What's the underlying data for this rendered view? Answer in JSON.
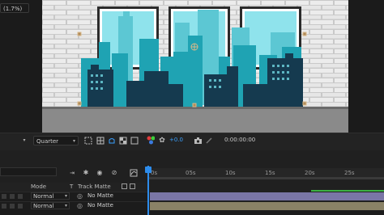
{
  "viewer": {
    "colors": {
      "sky": "#8fe3ec",
      "brick": "#e9e9e9",
      "mortar": "#c9c9c9",
      "floor": "#8a8a8a",
      "frame": "#2b2b2b",
      "mat": "#ffffff",
      "teal": "#1fa3b3",
      "teal_dark": "#16707e",
      "navy": "#153a4f"
    }
  },
  "toolbar": {
    "magnification": "(1.7%)",
    "resolution": "Quarter",
    "exposure": "+0.0",
    "timecode": "0:00:00:00",
    "icons": [
      "chevron-down-icon",
      "region-of-interest-icon",
      "grid-icon",
      "mask-icon",
      "channel-icon",
      "reset-exposure-icon",
      "snapshot-icon",
      "show-snapshot-icon"
    ]
  },
  "timeline": {
    "columns": {
      "mode": "Mode",
      "t": "T",
      "track_matte": "Track Matte"
    },
    "ruler": [
      "0s",
      "05s",
      "10s",
      "15s",
      "20s",
      "25s"
    ],
    "layers": [
      {
        "mode": "Normal",
        "track_matte": "No Matte"
      },
      {
        "mode": "Normal",
        "track_matte": "No Matte"
      }
    ],
    "colors": {
      "cti": "#2d8ceb",
      "bar1": "#7a76a6",
      "bar2": "#8a8266",
      "work_area": "#3cb043"
    }
  }
}
